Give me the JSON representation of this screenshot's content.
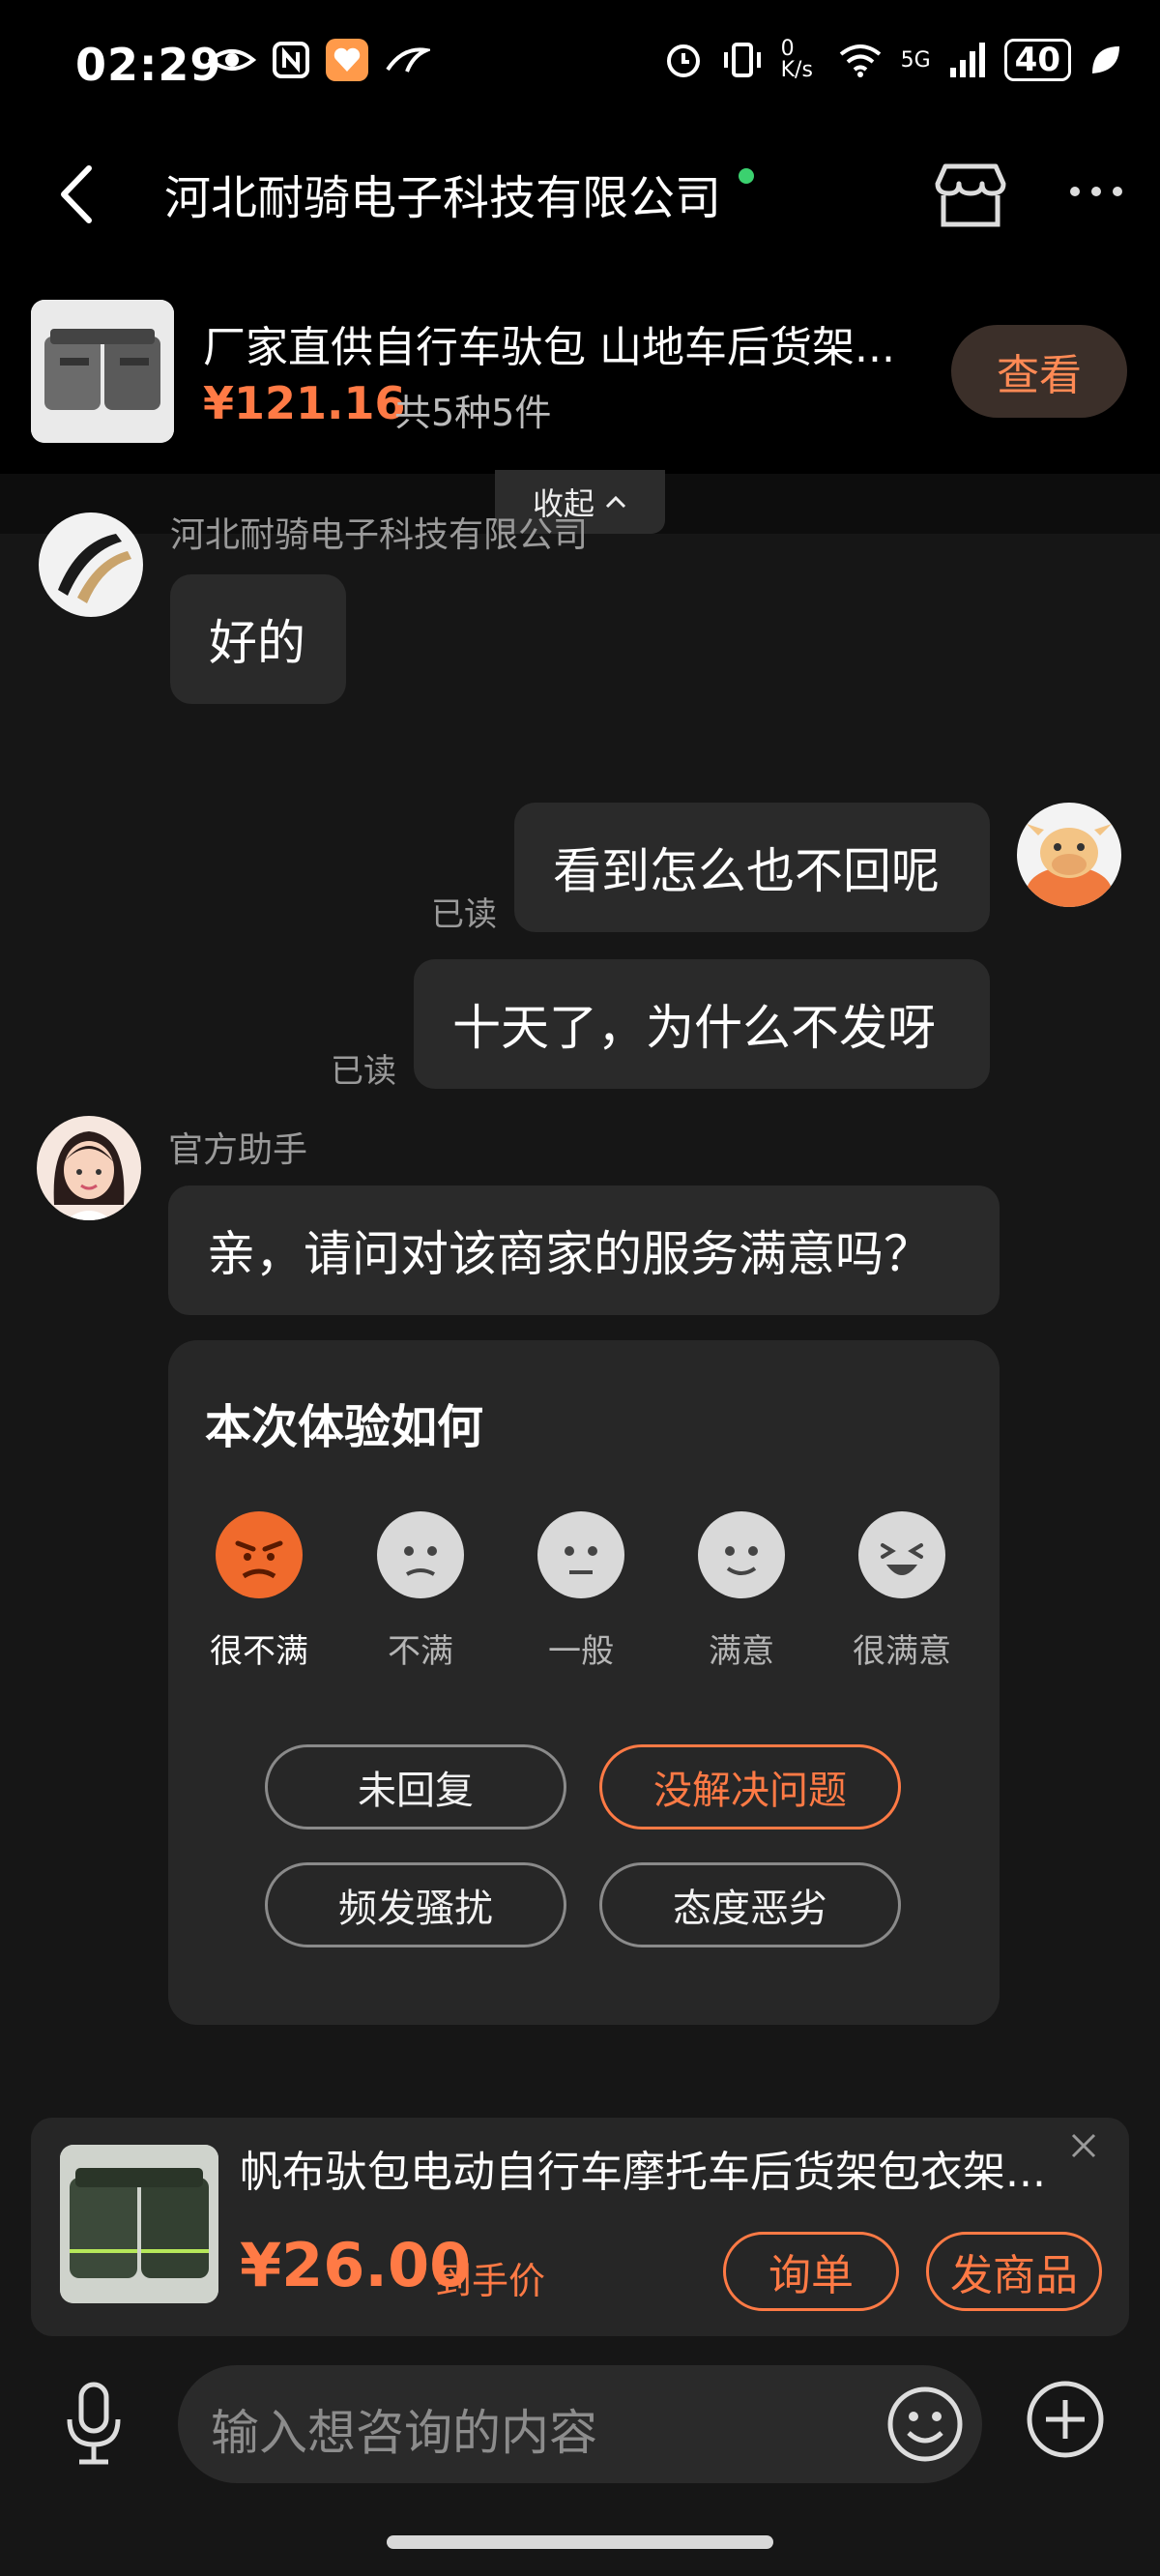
{
  "status_bar": {
    "time": "02:29",
    "network_speed": "0 K/s",
    "signal": "5G",
    "battery": "40"
  },
  "nav": {
    "title": "河北耐骑电子科技有限公司",
    "online_color": "#3bd16f",
    "icons": [
      "back-arrow-icon",
      "store-icon",
      "more-icon"
    ]
  },
  "product_header": {
    "title": "厂家直供自行车驮包 山地车后货架...",
    "price": "¥121.16",
    "count": "共5种5件",
    "view_button": "查看",
    "collapse_label": "收起"
  },
  "messages": [
    {
      "sender": "河北耐骑电子科技有限公司",
      "text": "好的"
    },
    {
      "text": "看到怎么也不回呢",
      "status": "已读"
    },
    {
      "text": "十天了，为什么不发呀",
      "status": "已读"
    },
    {
      "sender": "官方助手",
      "text": "亲，请问对该商家的服务满意吗？"
    }
  ],
  "survey": {
    "title": "本次体验如何",
    "ratings": [
      "很不满",
      "不满",
      "一般",
      "满意",
      "很满意"
    ],
    "selected_rating": "很不满",
    "options": [
      "未回复",
      "没解决问题",
      "频发骚扰",
      "态度恶劣"
    ],
    "selected_option": "没解决问题"
  },
  "recommendation": {
    "title": "帆布驮包电动自行车摩托车后货架包衣架...",
    "price": "¥26.00",
    "price_label": "到手价",
    "inquiry_button": "询单",
    "send_button": "发商品"
  },
  "input": {
    "placeholder": "输入想咨询的内容"
  },
  "colors": {
    "accent": "#ff7a45",
    "background": "#161616",
    "bubble": "#2a2a2a"
  }
}
